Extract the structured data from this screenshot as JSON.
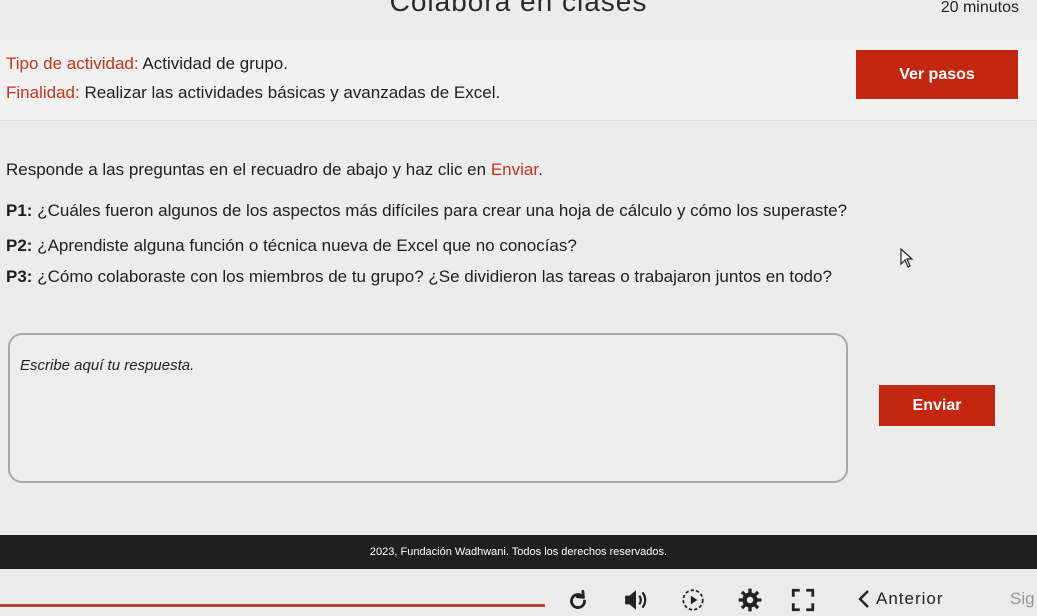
{
  "header": {
    "title": "Colabora en clases",
    "timer": "20 minutos"
  },
  "info": {
    "activity_label": "Tipo de actividad:",
    "activity_value": "Actividad de grupo.",
    "purpose_label": "Finalidad:",
    "purpose_value": "Realizar las actividades básicas y avanzadas de Excel.",
    "steps_button": "Ver pasos"
  },
  "instructions": {
    "text_before": "Responde a las preguntas en el  recuadro de abajo y haz clic en ",
    "highlight": "Enviar",
    "text_after": "."
  },
  "questions": [
    {
      "label": "P1:",
      "text": "¿Cuáles fueron algunos de los aspectos más difíciles para crear una hoja de cálculo y cómo los superaste?"
    },
    {
      "label": "P2:",
      "text": "¿Aprendiste alguna función o técnica nueva de Excel que no conocías?"
    },
    {
      "label": "P3:",
      "text": "¿Cómo colaboraste con los miembros de tu grupo? ¿Se dividieron las tareas o trabajaron juntos en todo?"
    }
  ],
  "answer": {
    "placeholder": "Escribe aquí tu respuesta.",
    "value": ""
  },
  "submit_button": "Enviar",
  "footer": {
    "copyright": "2023, Fundación Wadhwani. Todos los derechos reservados."
  },
  "toolbar": {
    "icons": [
      "reload-icon",
      "volume-icon",
      "play-icon",
      "settings-icon",
      "fullscreen-icon"
    ],
    "prev_label": "Anterior",
    "next_label": "Sig",
    "accent_color": "#c4270f"
  }
}
